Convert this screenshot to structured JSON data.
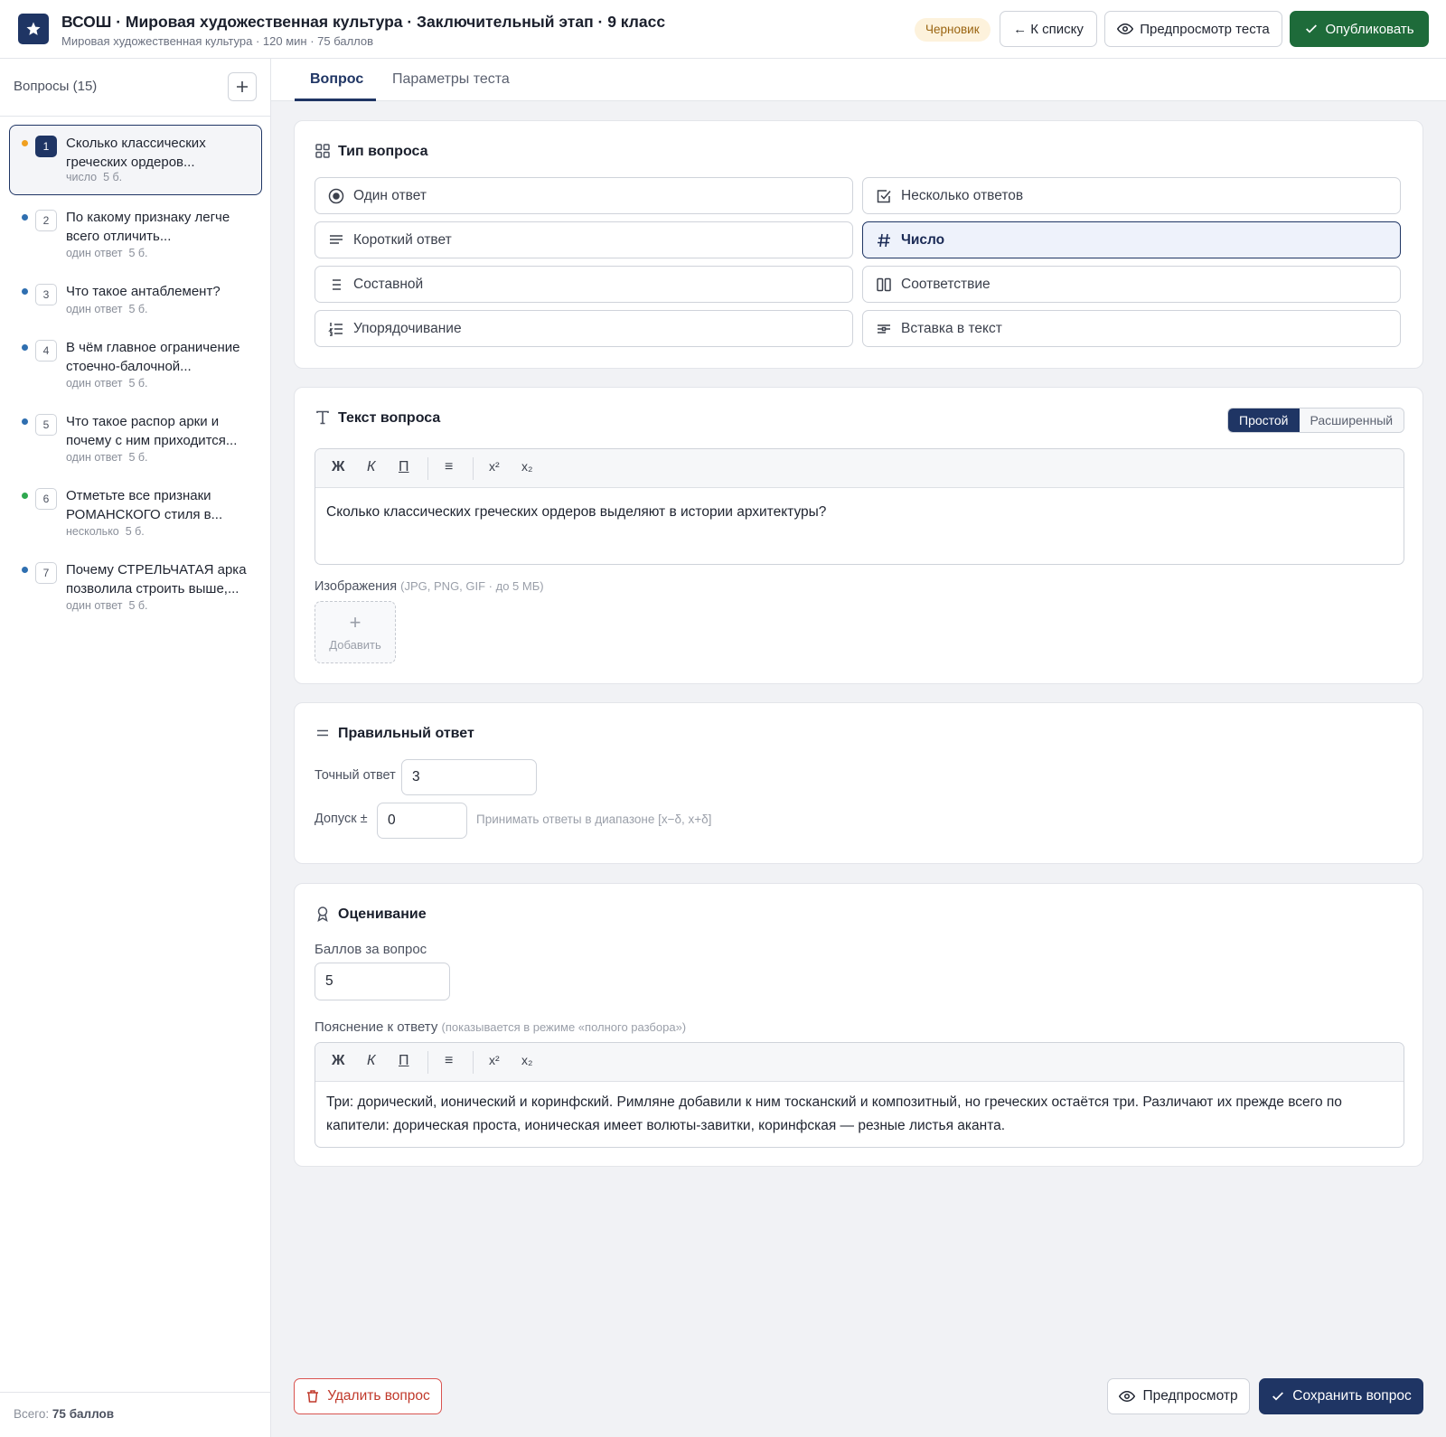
{
  "header": {
    "title": "ВСОШ · Мировая художественная культура · Заключительный этап · 9 класс",
    "subtitle": "Мировая художественная культура · 120 мин · 75 баллов",
    "status_badge": "Черновик",
    "back_label": "← К списку",
    "preview_test_label": "Предпросмотр теста",
    "publish_label": "Опубликовать"
  },
  "sidebar": {
    "title": "Вопросы (15)",
    "total_label": "Всего:",
    "total_value": "75 баллов",
    "questions": [
      {
        "num": "1",
        "text": "Сколько классических греческих ордеров...",
        "type": "число",
        "points": "5 б.",
        "dot": "#f0a020"
      },
      {
        "num": "2",
        "text": "По какому признаку легче всего отличить...",
        "type": "один ответ",
        "points": "5 б.",
        "dot": "#2f6fb0"
      },
      {
        "num": "3",
        "text": "Что такое антаблемент?",
        "type": "один ответ",
        "points": "5 б.",
        "dot": "#2f6fb0"
      },
      {
        "num": "4",
        "text": "В чём главное ограничение стоечно-балочной...",
        "type": "один ответ",
        "points": "5 б.",
        "dot": "#2f6fb0"
      },
      {
        "num": "5",
        "text": "Что такое распор арки и почему с ним приходится...",
        "type": "один ответ",
        "points": "5 б.",
        "dot": "#2f6fb0"
      },
      {
        "num": "6",
        "text": "Отметьте все признаки РОМАНСКОГО стиля в...",
        "type": "несколько",
        "points": "5 б.",
        "dot": "#2fa84f"
      },
      {
        "num": "7",
        "text": "Почему СТРЕЛЬЧАТАЯ арка позволила строить выше,...",
        "type": "один ответ",
        "points": "5 б.",
        "dot": "#2f6fb0"
      }
    ]
  },
  "tabs": {
    "question": "Вопрос",
    "params": "Параметры теста"
  },
  "question_type": {
    "title": "Тип вопроса",
    "options": [
      {
        "label": "Один ответ",
        "icon": "radio-icon"
      },
      {
        "label": "Несколько ответов",
        "icon": "checkbox-icon"
      },
      {
        "label": "Короткий ответ",
        "icon": "text-lines-icon"
      },
      {
        "label": "Число",
        "icon": "hash-icon",
        "selected": true
      },
      {
        "label": "Составной",
        "icon": "list-icon"
      },
      {
        "label": "Соответствие",
        "icon": "columns-icon"
      },
      {
        "label": "Упорядочивание",
        "icon": "ordered-list-icon"
      },
      {
        "label": "Вставка в текст",
        "icon": "insert-text-icon"
      }
    ]
  },
  "question_text": {
    "title": "Текст вопроса",
    "mode_simple": "Простой",
    "mode_advanced": "Расширенный",
    "toolbar": {
      "bold": "Ж",
      "italic": "К",
      "underline": "П",
      "list": "≡",
      "sup": "x²",
      "sub": "x₂"
    },
    "body": "Сколько классических греческих ордеров выделяют в истории архитектуры?",
    "images_label": "Изображения",
    "images_hint": "(JPG, PNG, GIF · до 5 МБ)",
    "add_image_label": "Добавить"
  },
  "correct_answer": {
    "title": "Правильный ответ",
    "exact_label": "Точный ответ",
    "exact_value": "3",
    "tolerance_label": "Допуск ±",
    "tolerance_value": "0",
    "tolerance_hint": "Принимать ответы в диапазоне [x−δ, x+δ]"
  },
  "grading": {
    "title": "Оценивание",
    "points_label": "Баллов за вопрос",
    "points_value": "5",
    "explanation_label": "Пояснение к ответу",
    "explanation_hint": "(показывается в режиме «полного разбора»)",
    "explanation_body": "Три: дорический, ионический и коринфский. Римляне добавили к ним тосканский и композитный, но греческих остаётся три. Различают их прежде всего по капители: дорическая проста, ионическая имеет волюты-завитки, коринфская — резные листья аканта."
  },
  "actions": {
    "delete_label": "Удалить вопрос",
    "preview_label": "Предпросмотр",
    "save_label": "Сохранить вопрос"
  },
  "colors": {
    "primary": "#1f3564",
    "publish": "#1e6b3a",
    "danger": "#c0392b"
  }
}
